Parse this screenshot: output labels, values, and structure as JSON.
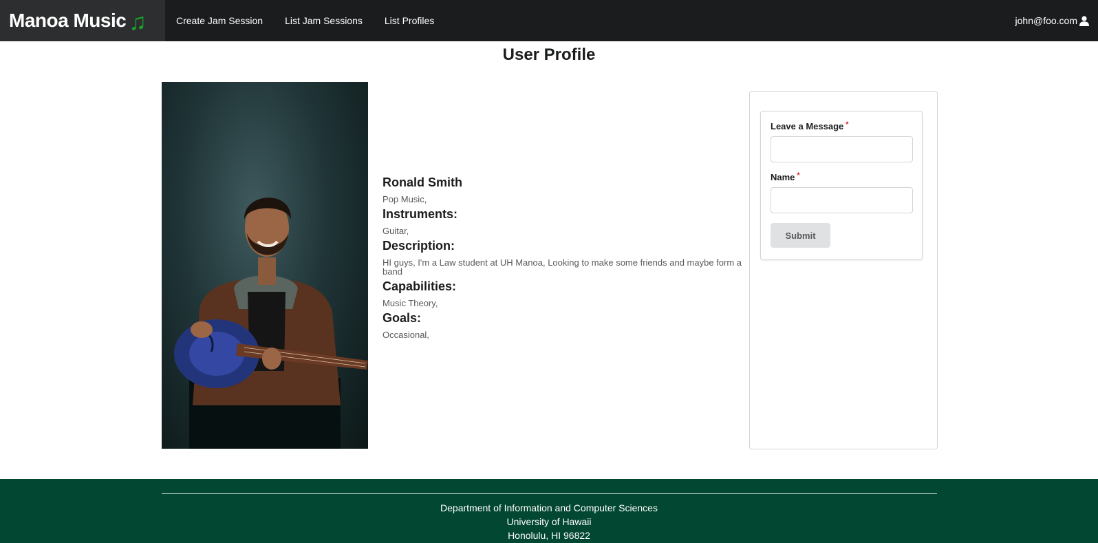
{
  "navbar": {
    "brand": "Manoa Music",
    "brand_icon": "♫",
    "links": [
      {
        "label": "Create Jam Session"
      },
      {
        "label": "List Jam Sessions"
      },
      {
        "label": "List Profiles"
      }
    ],
    "user_email": "john@foo.com"
  },
  "page": {
    "title": "User Profile"
  },
  "profile": {
    "name": "Ronald Smith",
    "genres": "Pop Music,",
    "instruments_heading": "Instruments:",
    "instruments": "Guitar,",
    "description_heading": "Description:",
    "description": "HI guys, I'm a Law student at UH Manoa, Looking to make some friends and maybe form a band",
    "capabilities_heading": "Capabilities:",
    "capabilities": "Music Theory,",
    "goals_heading": "Goals:",
    "goals": "Occasional,"
  },
  "message_form": {
    "message_label": "Leave a Message",
    "message_value": "",
    "name_label": "Name",
    "name_value": "",
    "required_mark": "*",
    "submit_label": "Submit"
  },
  "footer": {
    "line1": "Department of Information and Computer Sciences",
    "line2": "University of Hawaii",
    "line3": "Honolulu, HI 96822"
  },
  "colors": {
    "navbar_bg": "#1b1c1d",
    "brand_bg": "#2d2e2f",
    "brand_note": "#17a52c",
    "footer_bg": "#024731",
    "required": "#db2828"
  }
}
